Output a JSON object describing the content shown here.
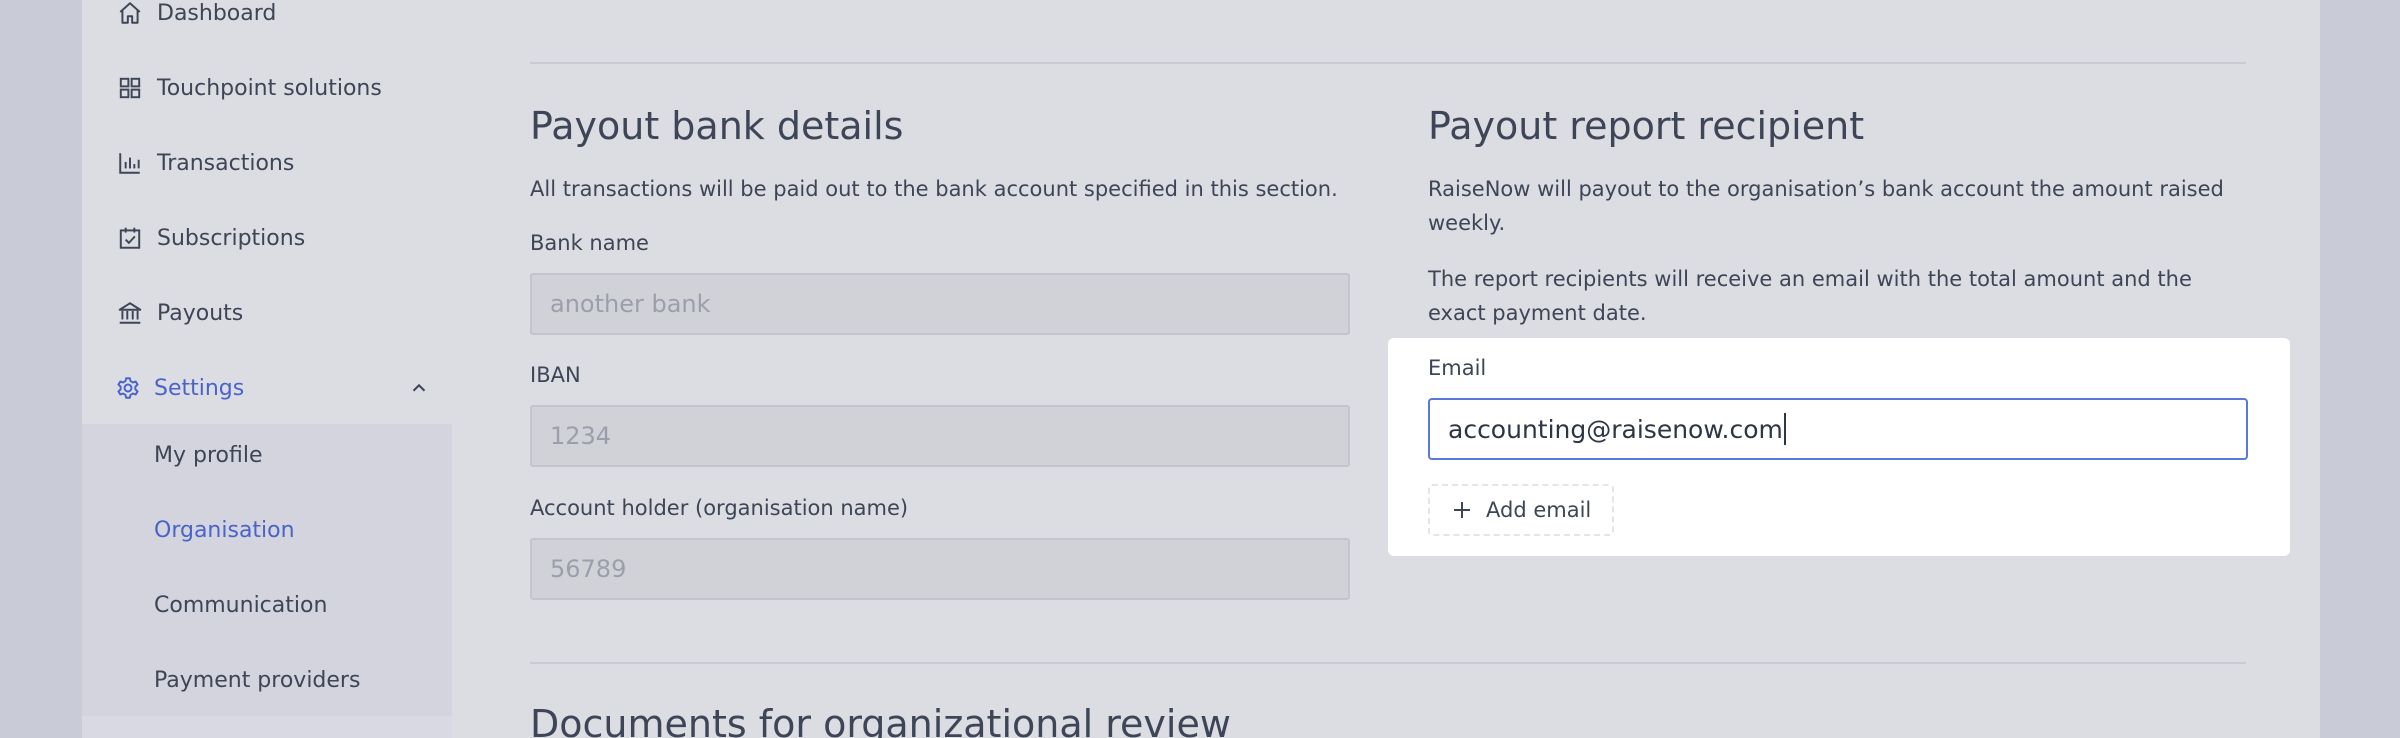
{
  "sidebar": {
    "items": [
      {
        "label": "Dashboard",
        "icon": "home-icon"
      },
      {
        "label": "Touchpoint solutions",
        "icon": "grid-icon"
      },
      {
        "label": "Transactions",
        "icon": "bar-chart-icon"
      },
      {
        "label": "Subscriptions",
        "icon": "calendar-check-icon"
      },
      {
        "label": "Payouts",
        "icon": "bank-icon"
      },
      {
        "label": "Settings",
        "icon": "gear-icon"
      }
    ],
    "settings_children": [
      {
        "label": "My profile"
      },
      {
        "label": "Organisation"
      },
      {
        "label": "Communication"
      },
      {
        "label": "Payment providers"
      }
    ]
  },
  "payout_bank": {
    "title": "Payout bank details",
    "description": "All transactions will be paid out to the bank account specified in this section.",
    "bank_name_label": "Bank name",
    "bank_name_value": "another bank",
    "iban_label": "IBAN",
    "iban_value": "1234",
    "holder_label": "Account holder (organisation name)",
    "holder_value": "56789"
  },
  "payout_report": {
    "title": "Payout report recipient",
    "description_1": "RaiseNow will payout to the organisation’s bank account the amount raised weekly.",
    "description_2": "The report recipients will receive an email with the total amount and the exact payment date.",
    "email_label": "Email",
    "email_value": "accounting@raisenow.com",
    "add_email_label": "Add email"
  },
  "documents": {
    "title": "Documents for organizational review"
  },
  "colors": {
    "accent": "#4a63c8",
    "focus_border": "#5a78d9",
    "text": "#3d4556",
    "background": "#dcdde3"
  }
}
